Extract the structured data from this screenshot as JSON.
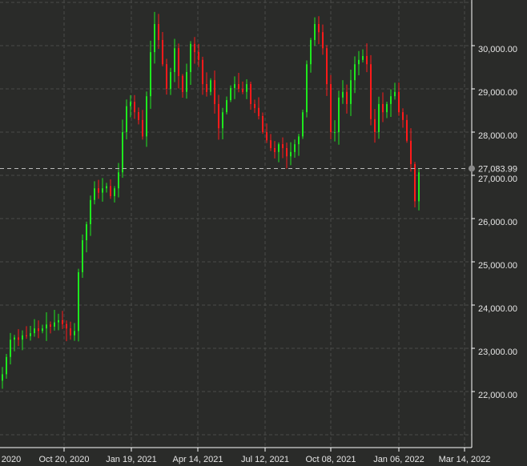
{
  "chart_data": {
    "type": "candlestick",
    "title": "",
    "xlabel": "",
    "ylabel": "",
    "ylim": [
      21000,
      31000
    ],
    "grid": true,
    "colors": {
      "up": "#1ee81e",
      "down": "#ff1a1a",
      "background": "#2a2b29",
      "grid": "#4a4b49",
      "axis": "#ffffff",
      "text": "#e6e6e6",
      "crosshair": "#bbbbbb"
    },
    "y_ticks": [
      22000,
      23000,
      24000,
      25000,
      26000,
      27000,
      28000,
      29000,
      30000
    ],
    "y_tick_labels": [
      "22,000.00",
      "23,000.00",
      "24,000.00",
      "25,000.00",
      "26,000.00",
      "27,000.00",
      "28,000.00",
      "29,000.00",
      "30,000.00"
    ],
    "x_ticks": [
      {
        "label": "2020",
        "index": -1.5
      },
      {
        "label": "Oct 20, 2020",
        "index": 15.6
      },
      {
        "label": "Jan 19, 2021",
        "index": 32.4
      },
      {
        "label": "Apr 14, 2021",
        "index": 49
      },
      {
        "label": "Jul 12, 2021",
        "index": 65.8
      },
      {
        "label": "Oct 08, 2021",
        "index": 82.2
      },
      {
        "label": "Jan 06, 2022",
        "index": 99.2
      },
      {
        "label": "Mar 14, 2022",
        "index": 115.6
      }
    ],
    "crosshair_value": 27083.99,
    "crosshair_label": "27,083.99",
    "closes": [
      22400,
      22800,
      23200,
      23250,
      23200,
      23300,
      23280,
      23350,
      23460,
      23400,
      23460,
      23550,
      23500,
      23600,
      23650,
      23560,
      23460,
      23300,
      23400,
      24760,
      25500,
      25870,
      26430,
      26700,
      26600,
      26700,
      26750,
      26520,
      26700,
      27070,
      28000,
      28600,
      28700,
      28460,
      28280,
      27900,
      28830,
      29850,
      30500,
      30130,
      29570,
      29000,
      29390,
      29940,
      29300,
      28930,
      29390,
      30040,
      29850,
      29670,
      29110,
      28930,
      29200,
      28650,
      28090,
      28460,
      28740,
      29020,
      29110,
      29000,
      28930,
      29110,
      28650,
      28560,
      28370,
      28000,
      27810,
      27630,
      27540,
      27720,
      27630,
      27440,
      27540,
      27720,
      27900,
      28460,
      29570,
      30130,
      30500,
      30310,
      29940,
      29110,
      28000,
      28000,
      28800,
      28930,
      28650,
      29200,
      29570,
      29670,
      29760,
      29570,
      28300,
      28000,
      28650,
      28460,
      28650,
      28830,
      28930,
      28460,
      28280,
      27800,
      27260,
      26400,
      27070
    ]
  }
}
